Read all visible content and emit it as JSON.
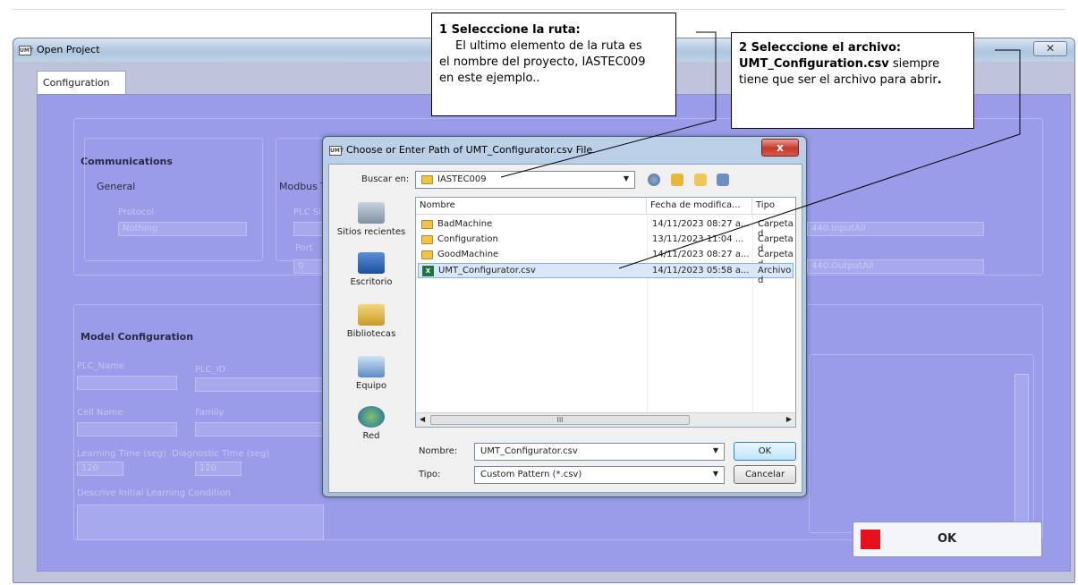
{
  "main_window": {
    "title": "Open Project",
    "close_glyph": "✕",
    "tab": "Configuration",
    "communications": {
      "label": "Communications",
      "general_label": "General",
      "protocol_label": "Protocol",
      "protocol_value": "Nothing",
      "modbus_label": "Modbus T",
      "plc_label": "PLC Sl",
      "port_label": "Port",
      "port_value": "0",
      "input_value": "440.InputAll",
      "output_value": "440.OutputAll"
    },
    "model_configuration": {
      "label": "Model Configuration",
      "plc_name_label": "PLC_Name",
      "plc_id_label": "PLC_ID",
      "cell_name_label": "Cell Name",
      "family_label": "Family",
      "learning_time_label": "Learning Time (seg)",
      "learning_time_value": "120",
      "diagnostic_time_label": "Diagnostic Time (seg)",
      "diagnostic_time_value": "120",
      "initial_condition_label": "Descrive Initial Learning Condition"
    },
    "ok_label": "OK",
    "ok_color": "#e8101a"
  },
  "file_dialog": {
    "title": "Choose or Enter Path of UMT_Configurator.csv File",
    "close_glyph": "x",
    "look_in_label": "Buscar en:",
    "look_in_value": "IASTEC009",
    "places": [
      "Sitios recientes",
      "Escritorio",
      "Bibliotecas",
      "Equipo",
      "Red"
    ],
    "columns": [
      "Nombre",
      "Fecha de modifica...",
      "Tipo"
    ],
    "files": [
      {
        "name": "BadMachine",
        "date": "14/11/2023 08:27 a...",
        "type": "Carpeta d",
        "icon": "folder-icon"
      },
      {
        "name": "Configuration",
        "date": "13/11/2023 11:04 ...",
        "type": "Carpeta d",
        "icon": "folder-icon"
      },
      {
        "name": "GoodMachine",
        "date": "14/11/2023 08:27 a...",
        "type": "Carpeta d",
        "icon": "folder-icon"
      },
      {
        "name": "UMT_Configurator.csv",
        "date": "14/11/2023 05:58 a...",
        "type": "Archivo d",
        "icon": "csv-file-icon"
      }
    ],
    "scroll_grip": "III",
    "name_label": "Nombre:",
    "name_value": "UMT_Configurator.csv",
    "type_label": "Tipo:",
    "type_value": "Custom Pattern (*.csv)",
    "ok_label": "OK",
    "cancel_label": "Cancelar"
  },
  "callouts": {
    "step1_title": "1 Selecccione la ruta:",
    "step1_line2": "El ultimo elemento de la ruta es",
    "step1_line3": "el nombre del proyecto, IASTEC009",
    "step1_line4": "en este ejemplo..",
    "step2_title": "2 Selecccione el archivo:",
    "step2_filename": "UMT_Configuration.csv",
    "step2_rest": " siempre",
    "step2_line2": "tiene que ser el archivo para abrir",
    "step2_period": "."
  }
}
